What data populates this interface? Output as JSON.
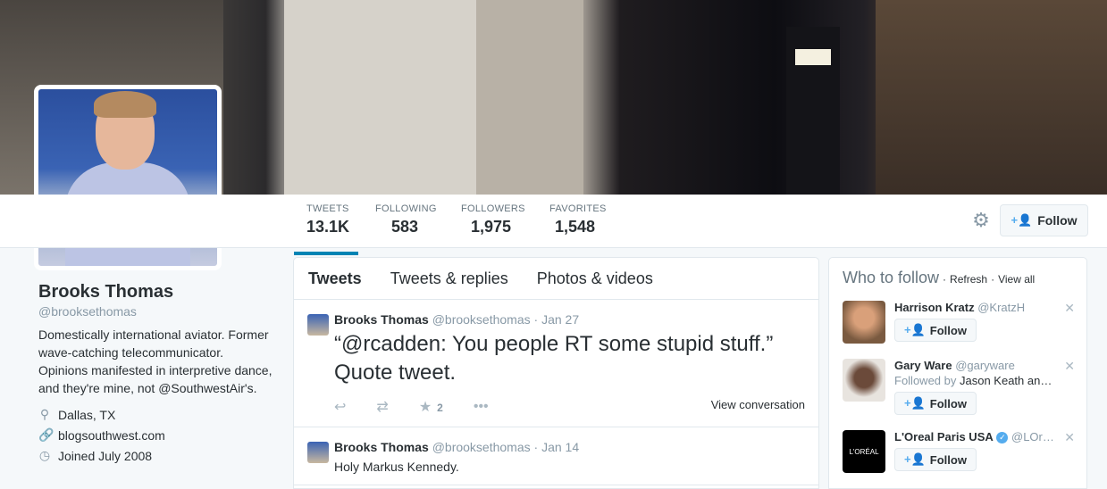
{
  "profile": {
    "name": "Brooks Thomas",
    "handle": "@brooksethomas",
    "bio": "Domestically international aviator. Former wave-catching telecommunicator. Opinions manifested in interpretive dance, and they're mine, not @SouthwestAir's.",
    "location": "Dallas, TX",
    "website": "blogsouthwest.com",
    "joined": "Joined July 2008"
  },
  "stats": [
    {
      "label": "TWEETS",
      "value": "13.1K"
    },
    {
      "label": "FOLLOWING",
      "value": "583"
    },
    {
      "label": "FOLLOWERS",
      "value": "1,975"
    },
    {
      "label": "FAVORITES",
      "value": "1,548"
    }
  ],
  "follow_label": "Follow",
  "tabs": [
    "Tweets",
    "Tweets & replies",
    "Photos & videos"
  ],
  "tweets": [
    {
      "name": "Brooks Thomas",
      "meta": "@brooksethomas · Jan 27",
      "text": "“@rcadden: You people RT some stupid stuff.” Quote tweet.",
      "fav_count": "2",
      "view_conversation": "View conversation"
    },
    {
      "name": "Brooks Thomas",
      "meta": "@brooksethomas · Jan 14",
      "text": "Holy Markus Kennedy."
    }
  ],
  "who_to_follow": {
    "title": "Who to follow",
    "refresh": "Refresh",
    "view_all": "View all",
    "sep": "·",
    "suggestions": [
      {
        "name": "Harrison Kratz",
        "handle": "@KratzH",
        "follow": "Follow"
      },
      {
        "name": "Gary Ware",
        "handle": "@garyware",
        "followed_prefix": "Followed by",
        "followed_by": "Jason Keath an…",
        "follow": "Follow"
      },
      {
        "name": "L'Oreal Paris USA",
        "handle": "@LOr…",
        "follow": "Follow",
        "logo_text": "L'ORÉAL"
      }
    ]
  },
  "icons": [
    "settings-gear-icon",
    "add-user-icon",
    "location-pin-icon",
    "link-icon",
    "calendar-icon",
    "reply-icon",
    "retweet-icon",
    "favorite-star-icon",
    "more-icon",
    "close-icon",
    "verified-icon"
  ]
}
